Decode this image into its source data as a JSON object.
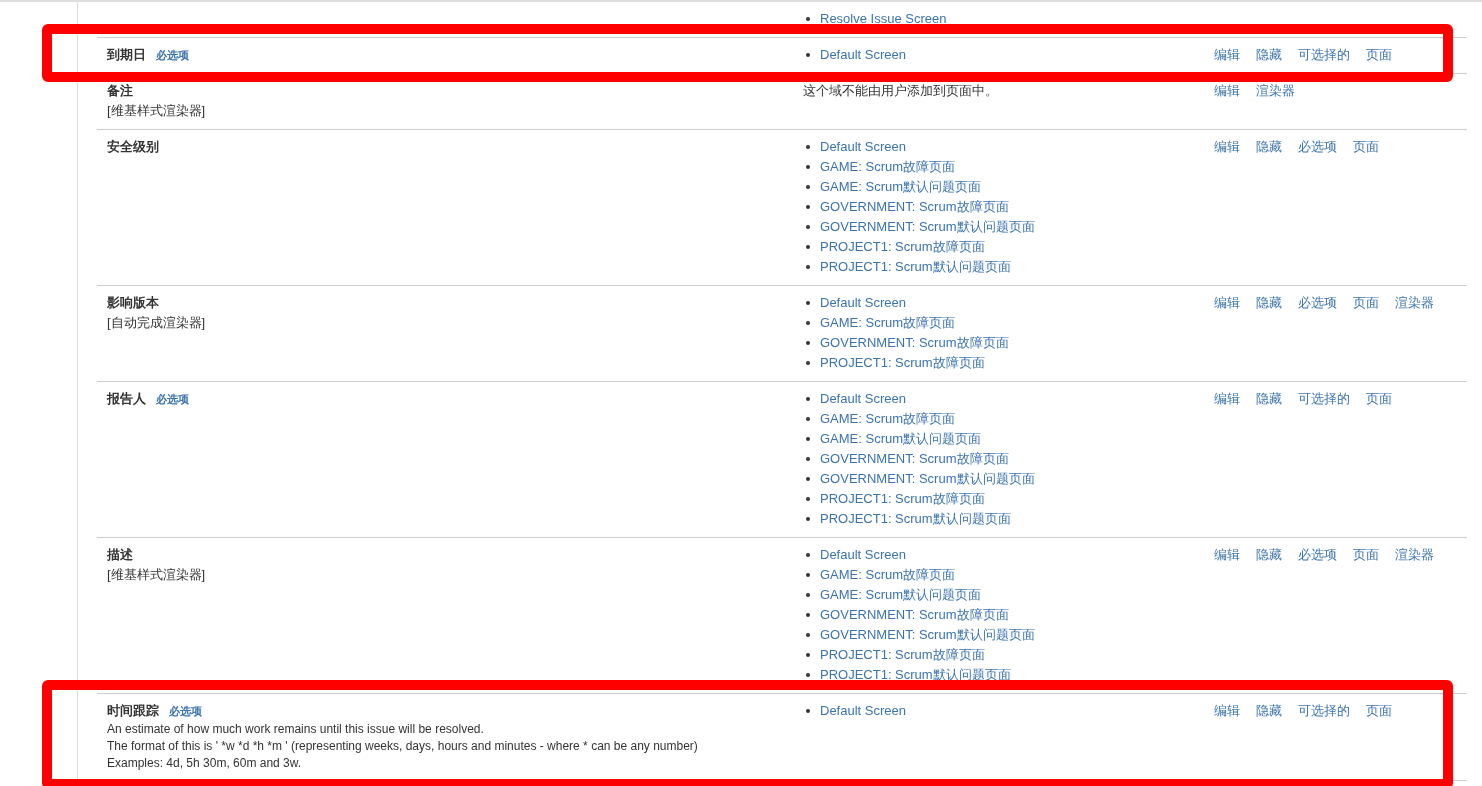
{
  "fields": [
    {
      "screens": [
        "Resolve Issue Screen"
      ],
      "highlighted": false
    },
    {
      "name": "到期日",
      "required_label": "必选项",
      "screens": [
        "Default Screen"
      ],
      "actions": [
        "编辑",
        "隐藏",
        "可选择的",
        "页面"
      ],
      "highlighted": true
    },
    {
      "name": "备注",
      "renderer": "[维基样式渲染器]",
      "note": "这个域不能由用户添加到页面中。",
      "actions": [
        "编辑",
        "渲染器"
      ],
      "highlighted": false
    },
    {
      "name": "安全级别",
      "screens": [
        "Default Screen",
        "GAME: Scrum故障页面",
        "GAME: Scrum默认问题页面",
        "GOVERNMENT: Scrum故障页面",
        "GOVERNMENT: Scrum默认问题页面",
        "PROJECT1: Scrum故障页面",
        "PROJECT1: Scrum默认问题页面"
      ],
      "actions": [
        "编辑",
        "隐藏",
        "必选项",
        "页面"
      ],
      "highlighted": false
    },
    {
      "name": "影响版本",
      "renderer": "[自动完成渲染器]",
      "screens": [
        "Default Screen",
        "GAME: Scrum故障页面",
        "GOVERNMENT: Scrum故障页面",
        "PROJECT1: Scrum故障页面"
      ],
      "actions": [
        "编辑",
        "隐藏",
        "必选项",
        "页面",
        "渲染器"
      ],
      "highlighted": false
    },
    {
      "name": "报告人",
      "required_label": "必选项",
      "screens": [
        "Default Screen",
        "GAME: Scrum故障页面",
        "GAME: Scrum默认问题页面",
        "GOVERNMENT: Scrum故障页面",
        "GOVERNMENT: Scrum默认问题页面",
        "PROJECT1: Scrum故障页面",
        "PROJECT1: Scrum默认问题页面"
      ],
      "actions": [
        "编辑",
        "隐藏",
        "可选择的",
        "页面"
      ],
      "highlighted": false
    },
    {
      "name": "描述",
      "renderer": "[维基样式渲染器]",
      "screens": [
        "Default Screen",
        "GAME: Scrum故障页面",
        "GAME: Scrum默认问题页面",
        "GOVERNMENT: Scrum故障页面",
        "GOVERNMENT: Scrum默认问题页面",
        "PROJECT1: Scrum故障页面",
        "PROJECT1: Scrum默认问题页面"
      ],
      "actions": [
        "编辑",
        "隐藏",
        "必选项",
        "页面",
        "渲染器"
      ],
      "highlighted": false
    },
    {
      "name": "时间跟踪",
      "required_label": "必选项",
      "description": [
        "An estimate of how much work remains until this issue will be resolved.",
        "The format of this is ' *w *d *h *m ' (representing weeks, days, hours and minutes - where * can be any number)",
        "Examples: 4d, 5h 30m, 60m and 3w."
      ],
      "screens": [
        "Default Screen"
      ],
      "actions": [
        "编辑",
        "隐藏",
        "可选择的",
        "页面"
      ],
      "highlighted": true
    }
  ]
}
